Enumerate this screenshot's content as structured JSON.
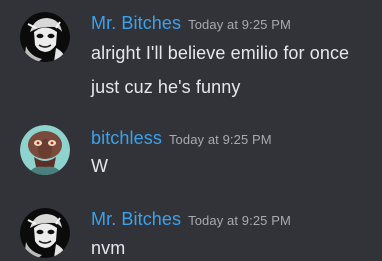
{
  "accent_username_color": "#3aa2ee",
  "background_color": "#313338",
  "messages": [
    {
      "author": "Mr. Bitches",
      "timestamp": "Today at 9:25 PM",
      "avatar_icon": "mask-portrait-avatar",
      "lines": [
        "alright I'll believe emilio for once",
        "just cuz he's funny"
      ]
    },
    {
      "author": "bitchless",
      "timestamp": "Today at 9:25 PM",
      "avatar_icon": "squidward-portrait-avatar",
      "lines": [
        "W"
      ]
    },
    {
      "author": "Mr. Bitches",
      "timestamp": "Today at 9:25 PM",
      "avatar_icon": "mask-portrait-avatar",
      "lines": [
        "nvm"
      ]
    }
  ]
}
